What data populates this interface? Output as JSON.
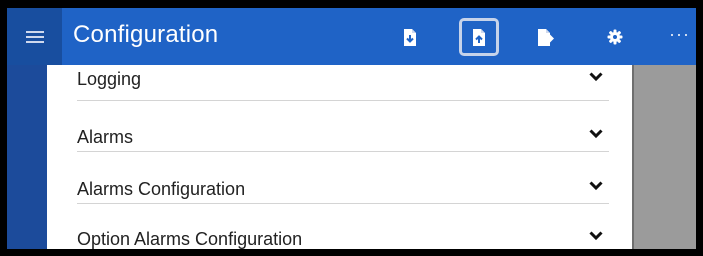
{
  "header": {
    "title": "Configuration",
    "menu_icon": "hamburger-icon",
    "toolbar": [
      {
        "name": "import-button",
        "icon": "file-download-icon",
        "active": false
      },
      {
        "name": "export-button",
        "icon": "file-upload-icon",
        "active": true
      },
      {
        "name": "logout-button",
        "icon": "file-export-icon",
        "active": false
      },
      {
        "name": "settings-button",
        "icon": "gear-icon",
        "active": false
      }
    ],
    "more_label": "···"
  },
  "sections": [
    {
      "label": "Logging"
    },
    {
      "label": "Alarms"
    },
    {
      "label": "Alarms Configuration"
    },
    {
      "label": "Option Alarms Configuration"
    }
  ],
  "colors": {
    "header": "#1f63c6",
    "menu_button": "#184e9f",
    "active_outline": "#c6d3ea",
    "background": "#9d9d9d"
  }
}
